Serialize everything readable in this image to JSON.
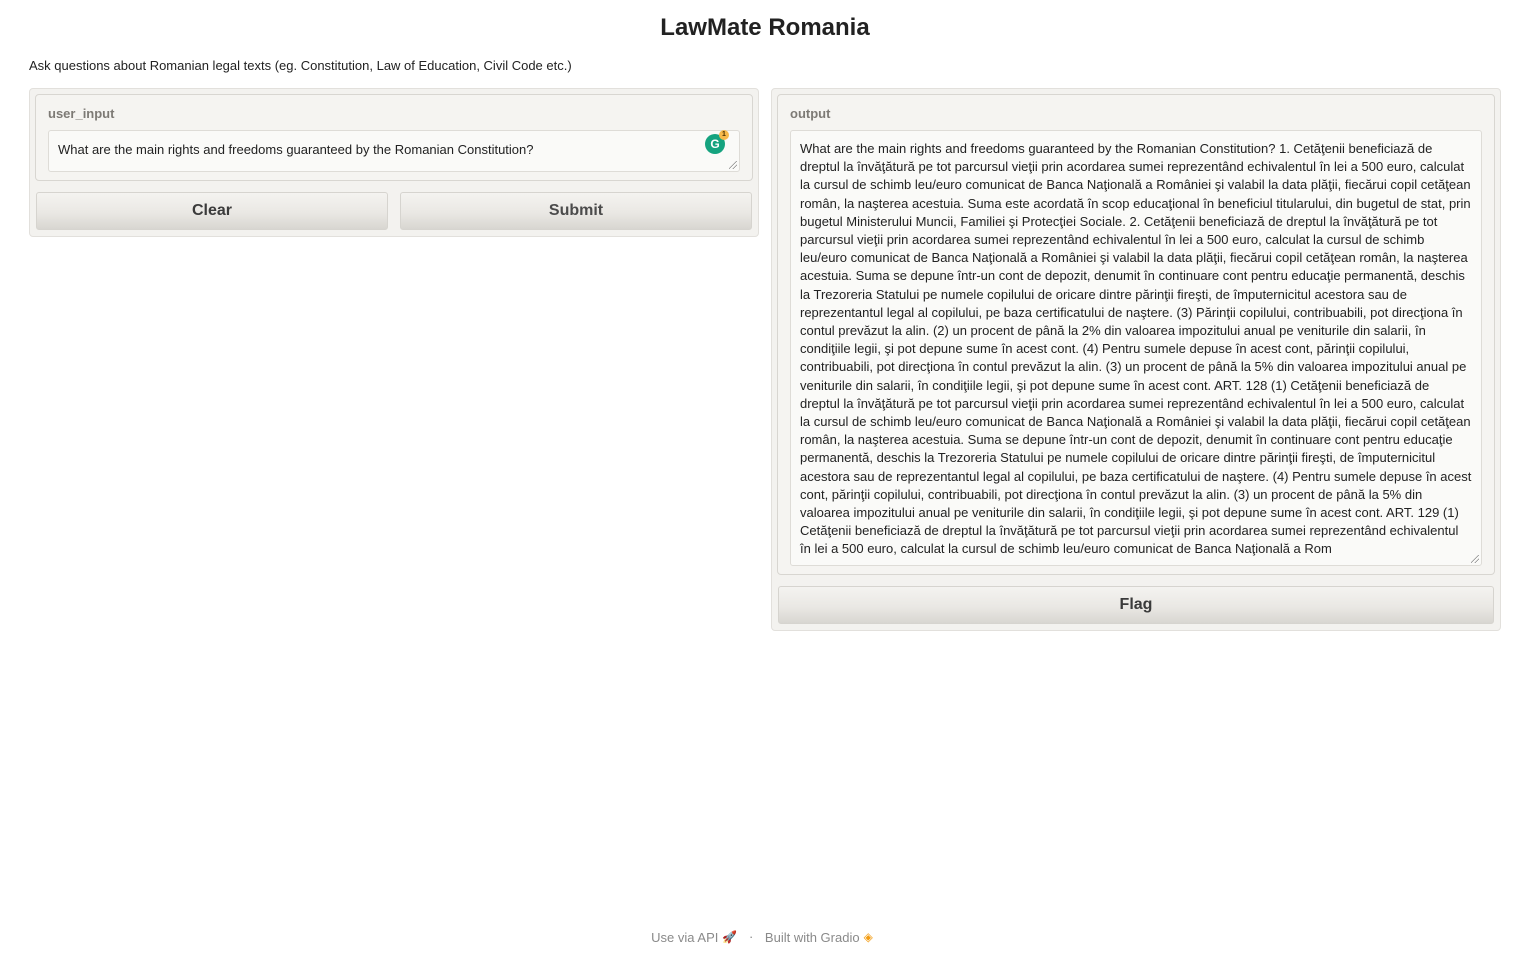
{
  "header": {
    "title": "LawMate Romania",
    "description": "Ask questions about Romanian legal texts (eg. Constitution, Law of Education, Civil Code etc.)"
  },
  "input_panel": {
    "label": "user_input",
    "value": "What are the main rights and freedoms guaranteed by the Romanian Constitution?",
    "grammarly_count": "1"
  },
  "buttons": {
    "clear": "Clear",
    "submit": "Submit",
    "flag": "Flag"
  },
  "output_panel": {
    "label": "output",
    "value": "What are the main rights and freedoms guaranteed by the Romanian Constitution? 1. Cetăţenii beneficiază de dreptul la învăţătură pe tot parcursul vieţii prin acordarea sumei reprezentând echivalentul în lei a 500 euro, calculat la cursul de schimb leu/euro comunicat de Banca Naţională a României şi valabil la data plăţii, fiecărui copil cetăţean român, la naşterea acestuia. Suma este acordată în scop educaţional în beneficiul titularului, din bugetul de stat, prin bugetul Ministerului Muncii, Familiei şi Protecţiei Sociale. 2. Cetăţenii beneficiază de dreptul la învăţătură pe tot parcursul vieţii prin acordarea sumei reprezentând echivalentul în lei a 500 euro, calculat la cursul de schimb leu/euro comunicat de Banca Naţională a României şi valabil la data plăţii, fiecărui copil cetăţean român, la naşterea acestuia. Suma se depune într-un cont de depozit, denumit în continuare cont pentru educaţie permanentă, deschis la Trezoreria Statului pe numele copilului de oricare dintre părinţii fireşti, de împuternicitul acestora sau de reprezentantul legal al copilului, pe baza certificatului de naştere. (3) Părinţii copilului, contribuabili, pot direcţiona în contul prevăzut la alin. (2) un procent de până la 2% din valoarea impozitului anual pe veniturile din salarii, în condiţiile legii, şi pot depune sume în acest cont. (4) Pentru sumele depuse în acest cont, părinţii copilului, contribuabili, pot direcţiona în contul prevăzut la alin. (3) un procent de până la 5% din valoarea impozitului anual pe veniturile din salarii, în condiţiile legii, şi pot depune sume în acest cont. ART. 128 (1) Cetăţenii beneficiază de dreptul la învăţătură pe tot parcursul vieţii prin acordarea sumei reprezentând echivalentul în lei a 500 euro, calculat la cursul de schimb leu/euro comunicat de Banca Naţională a României şi valabil la data plăţii, fiecărui copil cetăţean român, la naşterea acestuia. Suma se depune într-un cont de depozit, denumit în continuare cont pentru educaţie permanentă, deschis la Trezoreria Statului pe numele copilului de oricare dintre părinţii fireşti, de împuternicitul acestora sau de reprezentantul legal al copilului, pe baza certificatului de naştere. (4) Pentru sumele depuse în acest cont, părinţii copilului, contribuabili, pot direcţiona în contul prevăzut la alin. (3) un procent de până la 5% din valoarea impozitului anual pe veniturile din salarii, în condiţiile legii, şi pot depune sume în acest cont. ART. 129 (1) Cetăţenii beneficiază de dreptul la învăţătură pe tot parcursul vieţii prin acordarea sumei reprezentând echivalentul în lei a 500 euro, calculat la cursul de schimb leu/euro comunicat de Banca Naţională a Rom"
  },
  "footer": {
    "api_link": "Use via API",
    "separator": "·",
    "built_with": "Built with Gradio"
  },
  "colors": {
    "panel_bg": "#f3f2ef",
    "grammarly": "#15a37f"
  }
}
